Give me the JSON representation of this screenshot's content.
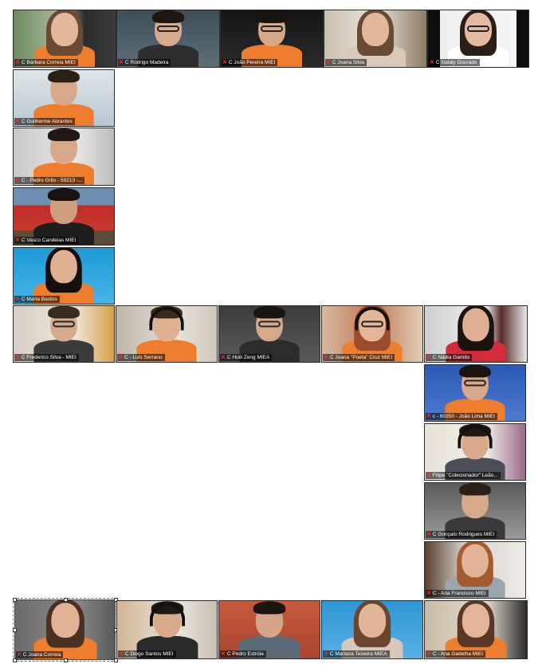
{
  "participants": [
    {
      "name": "C Bárbara Correia MIEI"
    },
    {
      "name": "C Rodrigo Madeira"
    },
    {
      "name": "C João Pereira MIEI"
    },
    {
      "name": "C Joana Silva"
    },
    {
      "name": "C Nataly Dourado"
    },
    {
      "name": "C Guilherme Abrantes"
    },
    {
      "name": "C - Pedro Grilo - 59213 -..."
    },
    {
      "name": "C Vasco Candeias MIEI"
    },
    {
      "name": "C Marta Bastos"
    },
    {
      "name": "C Frederico Silva - MIEI"
    },
    {
      "name": "C - Luís Serrano"
    },
    {
      "name": "C Huili Zeng MIEA"
    },
    {
      "name": "C Joana \"Poeta\" Cruz MIEI"
    },
    {
      "name": "C Nádia Gamito"
    },
    {
      "name": "c - 60350 - João Lima MIEI"
    },
    {
      "name": "Filipe \"Colecionador\" Leão..."
    },
    {
      "name": "C Gonçalo Rodrigues MIEI"
    },
    {
      "name": "C - Ana Francisco MIEI"
    },
    {
      "name": "C Joana Correia"
    },
    {
      "name": "C Diogo Santos MIEI"
    },
    {
      "name": "C Pedro Estróia"
    },
    {
      "name": "C Mariana Teixeira MIEA"
    },
    {
      "name": "C - Ana Gadelha MIEI"
    }
  ],
  "icons": {
    "muted": "muted-mic-icon"
  },
  "colors": {
    "shirt": "#ef7d2e",
    "mic": "#e53935",
    "background": "#ffffff"
  }
}
